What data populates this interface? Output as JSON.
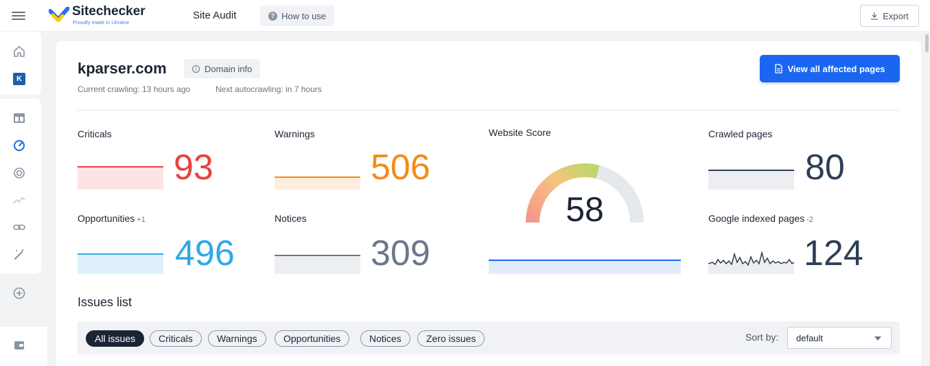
{
  "topbar": {
    "brand_name": "Sitechecker",
    "brand_tagline": "Proudly made in Ukraine",
    "app_title": "Site Audit",
    "how_to_use_label": "How to use",
    "export_label": "Export"
  },
  "sidebar": {
    "project_badge": "K",
    "icons": [
      "home-icon",
      "project-badge",
      "dashboard-icon",
      "site-audit-icon",
      "rank-tracker-icon",
      "analytics-icon",
      "backlinks-icon",
      "magic-wand-icon",
      "add-icon",
      "wallet-icon"
    ]
  },
  "header": {
    "domain": "kparser.com",
    "domain_info_label": "Domain info",
    "current_crawling": "Current crawling: 13 hours ago",
    "next_autocrawling": "Next autocrawling: in 7 hours",
    "view_all_label": "View all affected pages"
  },
  "metrics": {
    "criticals": {
      "label": "Criticals",
      "value": "93",
      "color": "#e8423c"
    },
    "warnings": {
      "label": "Warnings",
      "value": "506",
      "color": "#f38c17"
    },
    "opportunities": {
      "label": "Opportunities",
      "delta": "+1",
      "value": "496",
      "color": "#2ea9e6"
    },
    "notices": {
      "label": "Notices",
      "value": "309",
      "color": "#6b778a"
    },
    "website_score": {
      "label": "Website Score",
      "value": "58",
      "score": 58
    },
    "crawled_pages": {
      "label": "Crawled pages",
      "value": "80",
      "color": "#2d3e55"
    },
    "google_indexed": {
      "label": "Google indexed pages",
      "delta": "-2",
      "value": "124",
      "color": "#2d3e55"
    }
  },
  "issues": {
    "title": "Issues list",
    "filters": [
      "All issues",
      "Criticals",
      "Warnings",
      "Opportunities",
      "Notices",
      "Zero issues"
    ],
    "active_filter": "All issues",
    "sort_label": "Sort by:",
    "sort_value": "default"
  }
}
